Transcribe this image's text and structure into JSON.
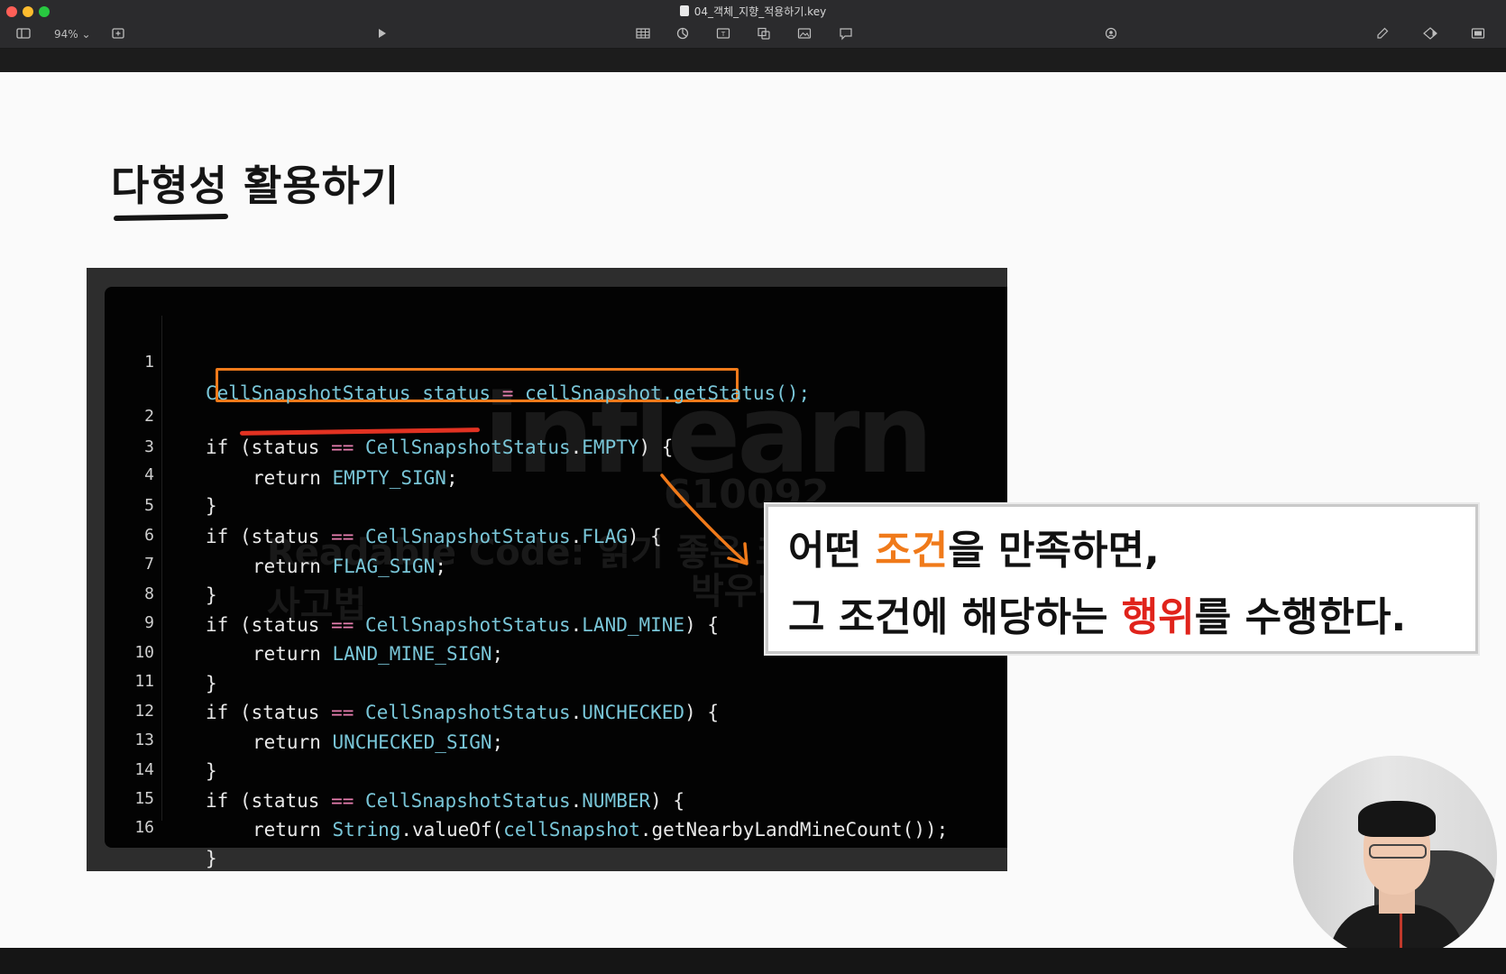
{
  "window": {
    "title": "04_객체_지향_적용하기.key",
    "zoom": "94%"
  },
  "toolbar": {
    "icons": [
      "sidebar-icon",
      "add-slide-icon",
      "play-icon",
      "table-icon",
      "chart-icon",
      "text-icon",
      "shape-icon",
      "media-icon",
      "comment-icon",
      "collaborate-icon",
      "format-icon",
      "animate-icon",
      "document-icon"
    ]
  },
  "slide": {
    "title": "다형성 활용하기"
  },
  "code": {
    "lines": [
      {
        "n": "1"
      },
      {
        "n": "2"
      },
      {
        "n": "3"
      },
      {
        "n": "4"
      },
      {
        "n": "5"
      },
      {
        "n": "6"
      },
      {
        "n": "7"
      },
      {
        "n": "8"
      },
      {
        "n": "9"
      },
      {
        "n": "10"
      },
      {
        "n": "11"
      },
      {
        "n": "12"
      },
      {
        "n": "13"
      },
      {
        "n": "14"
      },
      {
        "n": "15"
      },
      {
        "n": "16"
      }
    ],
    "tokens": {
      "l1": [
        "CellSnapshotStatus",
        " status ",
        "=",
        " cellSnapshot.getStatus();"
      ],
      "l2": [
        "if",
        " (status ",
        "==",
        " ",
        "CellSnapshotStatus",
        ".",
        "EMPTY",
        ") {"
      ],
      "l3": [
        "return",
        " ",
        "EMPTY_SIGN",
        ";"
      ],
      "l4": [
        "}"
      ],
      "l5": [
        "if",
        " (status ",
        "==",
        " ",
        "CellSnapshotStatus",
        ".",
        "FLAG",
        ") {"
      ],
      "l6": [
        "return",
        " ",
        "FLAG_SIGN",
        ";"
      ],
      "l7": [
        "}"
      ],
      "l8": [
        "if",
        " (status ",
        "==",
        " ",
        "CellSnapshotStatus",
        ".",
        "LAND_MINE",
        ") {"
      ],
      "l9": [
        "return",
        " ",
        "LAND_MINE_SIGN",
        ";"
      ],
      "l10": [
        "}"
      ],
      "l11": [
        "if",
        " (status ",
        "==",
        " ",
        "CellSnapshotStatus",
        ".",
        "UNCHECKED",
        ") {"
      ],
      "l12": [
        "return",
        " ",
        "UNCHECKED_SIGN",
        ";"
      ],
      "l13": [
        "}"
      ],
      "l14": [
        "if",
        " (status ",
        "==",
        " ",
        "CellSnapshotStatus",
        ".",
        "NUMBER",
        ") {"
      ],
      "l15": [
        "return",
        " ",
        "String",
        ".valueOf(",
        "cellSnapshot",
        ".getNearbyLandMineCount());"
      ],
      "l16": [
        "}"
      ]
    }
  },
  "watermark": {
    "logo": "inflearn",
    "id": "610092",
    "course": "Readable Code: 읽기 좋은 코드를 작성하는 사고법",
    "name": "박우빈"
  },
  "callout": {
    "line1_pre": "어떤 ",
    "line1_hl": "조건",
    "line1_post": "을 만족하면,",
    "line2_pre": "그 조건에 해당하는 ",
    "line2_hl": "행위",
    "line2_post": "를 수행한다."
  },
  "colors": {
    "highlight_box": "#f07a1a",
    "underline": "#e23222",
    "callout_orange": "#f07a1a",
    "callout_red": "#e0231b"
  }
}
